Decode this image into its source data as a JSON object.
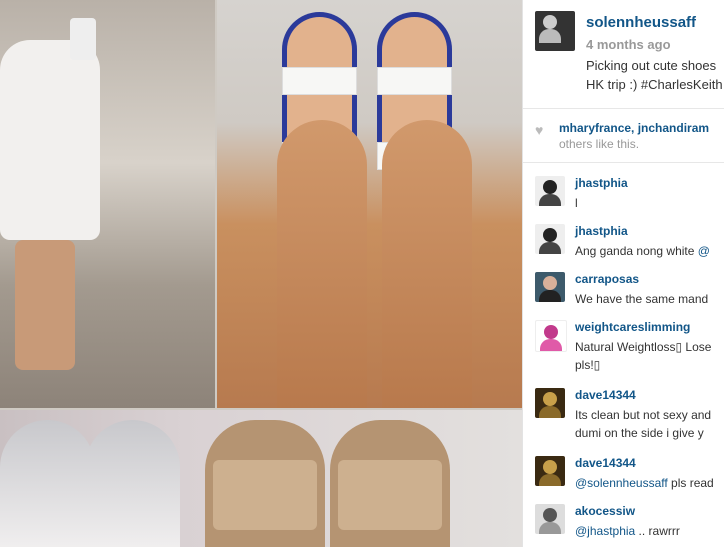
{
  "post": {
    "username": "solennheussaff",
    "time": "4 months ago",
    "caption_line1": "Picking out cute shoes",
    "caption_line2": "HK trip :) #CharlesKeith"
  },
  "likes": {
    "names": "mharyfrance, jnchandiram",
    "others": "others like this."
  },
  "comments": [
    {
      "user": "jhastphia",
      "text": "l"
    },
    {
      "user": "jhastphia",
      "text": "Ang ganda nong white ",
      "mention": "@"
    },
    {
      "user": "carraposas",
      "text": "We have the same mand"
    },
    {
      "user": "weightcareslimming",
      "text": "Natural Weightloss▯ Lose",
      "text2": "pls!▯"
    },
    {
      "user": "dave14344",
      "text": "Its clean but not sexy and",
      "text2": "dumi on the side i give y"
    },
    {
      "user": "dave14344",
      "mention": "@solennheussaff",
      "text": " pls read"
    },
    {
      "user": "akocessiw",
      "mention": "@jhastphia",
      "text": " .. rawrrr"
    }
  ]
}
